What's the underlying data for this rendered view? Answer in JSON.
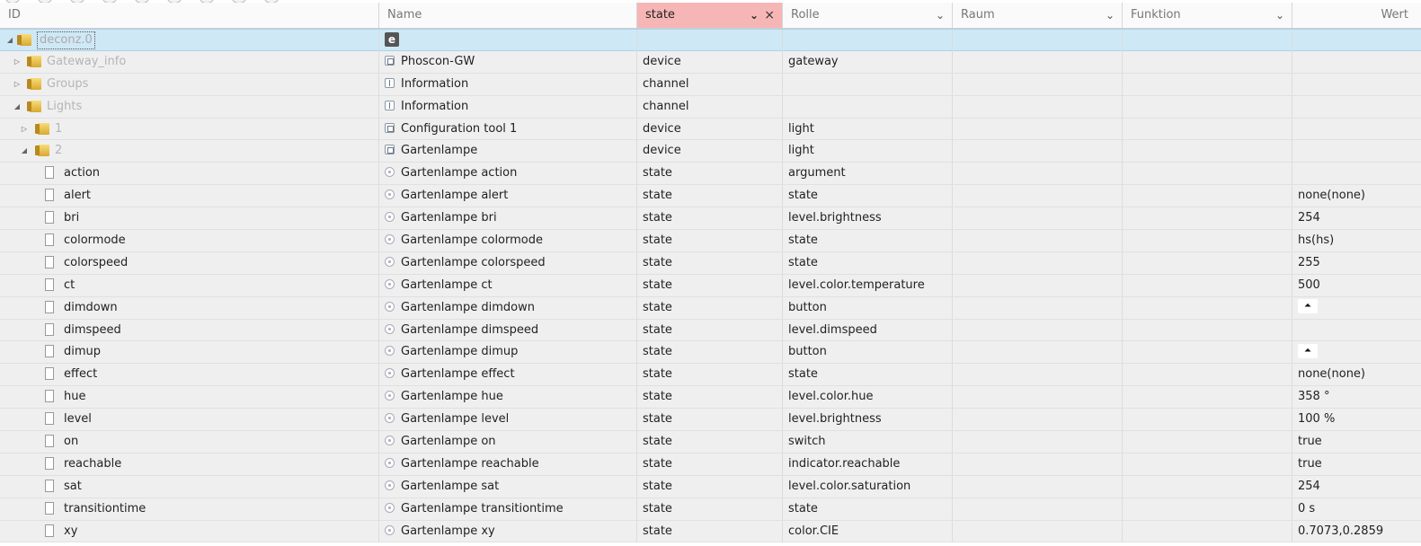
{
  "header": {
    "id": "ID",
    "name": "Name",
    "type": "state",
    "role": "Rolle",
    "room": "Raum",
    "function": "Funktion",
    "value": "Wert"
  },
  "icons": {
    "adapter_logo": "e",
    "button_glyph": "⏶",
    "collapsed": "▷",
    "expanded": "◢"
  },
  "rows": [
    {
      "kind": "root",
      "label": "deconz.0",
      "name": "",
      "type": "",
      "role": "",
      "value": ""
    },
    {
      "kind": "folder",
      "label": "Gateway_info",
      "name": "Phoscon-GW",
      "type": "device",
      "role": "gateway",
      "value": ""
    },
    {
      "kind": "folder",
      "label": "Groups",
      "name": "Information",
      "type": "channel",
      "role": "",
      "value": ""
    },
    {
      "kind": "folder",
      "label": "Lights",
      "name": "Information",
      "type": "channel",
      "role": "",
      "value": ""
    },
    {
      "kind": "folder",
      "label": "1",
      "name": "Configuration tool 1",
      "type": "device",
      "role": "light",
      "value": ""
    },
    {
      "kind": "folder",
      "label": "2",
      "name": "Gartenlampe",
      "type": "device",
      "role": "light",
      "value": ""
    },
    {
      "kind": "state",
      "label": "action",
      "name": "Gartenlampe action",
      "type": "state",
      "role": "argument",
      "value": ""
    },
    {
      "kind": "state",
      "label": "alert",
      "name": "Gartenlampe alert",
      "type": "state",
      "role": "state",
      "value": "none(none)"
    },
    {
      "kind": "state",
      "label": "bri",
      "name": "Gartenlampe bri",
      "type": "state",
      "role": "level.brightness",
      "value": "254"
    },
    {
      "kind": "state",
      "label": "colormode",
      "name": "Gartenlampe colormode",
      "type": "state",
      "role": "state",
      "value": "hs(hs)"
    },
    {
      "kind": "state",
      "label": "colorspeed",
      "name": "Gartenlampe colorspeed",
      "type": "state",
      "role": "state",
      "value": "255"
    },
    {
      "kind": "state",
      "label": "ct",
      "name": "Gartenlampe ct",
      "type": "state",
      "role": "level.color.temperature",
      "value": "500"
    },
    {
      "kind": "state",
      "label": "dimdown",
      "name": "Gartenlampe dimdown",
      "type": "state",
      "role": "button",
      "value": ""
    },
    {
      "kind": "state",
      "label": "dimspeed",
      "name": "Gartenlampe dimspeed",
      "type": "state",
      "role": "level.dimspeed",
      "value": ""
    },
    {
      "kind": "state",
      "label": "dimup",
      "name": "Gartenlampe dimup",
      "type": "state",
      "role": "button",
      "value": ""
    },
    {
      "kind": "state",
      "label": "effect",
      "name": "Gartenlampe effect",
      "type": "state",
      "role": "state",
      "value": "none(none)"
    },
    {
      "kind": "state",
      "label": "hue",
      "name": "Gartenlampe hue",
      "type": "state",
      "role": "level.color.hue",
      "value": "358 °"
    },
    {
      "kind": "state",
      "label": "level",
      "name": "Gartenlampe level",
      "type": "state",
      "role": "level.brightness",
      "value": "100 %"
    },
    {
      "kind": "state",
      "label": "on",
      "name": "Gartenlampe on",
      "type": "state",
      "role": "switch",
      "value": "true"
    },
    {
      "kind": "state",
      "label": "reachable",
      "name": "Gartenlampe reachable",
      "type": "state",
      "role": "indicator.reachable",
      "value": "true"
    },
    {
      "kind": "state",
      "label": "sat",
      "name": "Gartenlampe sat",
      "type": "state",
      "role": "level.color.saturation",
      "value": "254"
    },
    {
      "kind": "state",
      "label": "transitiontime",
      "name": "Gartenlampe transitiontime",
      "type": "state",
      "role": "state",
      "value": "0 s"
    },
    {
      "kind": "state",
      "label": "xy",
      "name": "Gartenlampe xy",
      "type": "state",
      "role": "color.CIE",
      "value": "0.7073,0.2859"
    }
  ]
}
